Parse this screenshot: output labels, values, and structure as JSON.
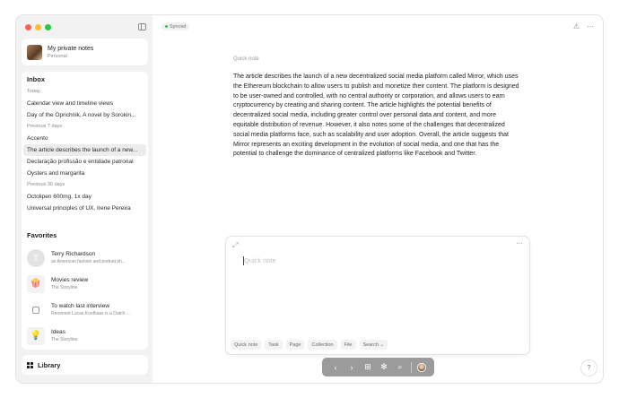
{
  "sidebar": {
    "account": {
      "name": "My private notes",
      "subtitle": "Personal"
    },
    "inbox": {
      "title": "Inbox",
      "groups": [
        {
          "label": "Today",
          "items": [
            "Calendar view and timeline views",
            "Day of the Oprichnik, A novel by Sorokin..."
          ]
        },
        {
          "label": "Previous 7 days",
          "items": [
            "Accento",
            "The article describes the launch of a new...",
            "Declaração profissão e entidade patronal",
            "Oysters and margarita"
          ]
        },
        {
          "label": "Previous 30 days",
          "items": [
            "Octolipen 600mg, 1x day",
            "Universal principles of UX, Irene Pereira"
          ]
        }
      ]
    },
    "favorites": {
      "title": "Favorites",
      "items": [
        {
          "title": "Terry Richardson",
          "subtitle": "an American fashion and portrait ph...",
          "icon": "T"
        },
        {
          "title": "Movies review",
          "subtitle": "The Storyline",
          "icon": "🍿"
        },
        {
          "title": "To watch last interview",
          "subtitle": "Remment Lucas Koolhaas is a Dutch ...",
          "icon": ""
        },
        {
          "title": "Ideas",
          "subtitle": "The Storyline",
          "icon": "💡"
        }
      ]
    },
    "library": {
      "label": "Library"
    }
  },
  "main": {
    "status": "Synced",
    "doc_label": "Quick note",
    "doc_body": "The article describes the launch of a new decentralized social media platform called Mirror, which uses the Ethereum blockchain to allow users to publish and monetize their content. The platform is designed to be user-owned and controlled, with no central authority or corporation, and allows users to earn cryptocurrency by creating and sharing content. The article highlights the potential benefits of decentralized social media, including greater control over personal data and content, and more equitable distribution of revenue. However, it also notes some of the challenges that decentralized social media platforms face, such as scalability and user adoption. Overall, the article suggests that Mirror represents an exciting development in the evolution of social media, and one that has the potential to challenge the dominance of centralized platforms like Facebook and Twitter."
  },
  "quick_panel": {
    "placeholder": "Quick note",
    "chips": [
      "Quick note",
      "Task",
      "Page",
      "Collection",
      "File",
      "Search ⌄"
    ]
  },
  "help": {
    "label": "?"
  }
}
